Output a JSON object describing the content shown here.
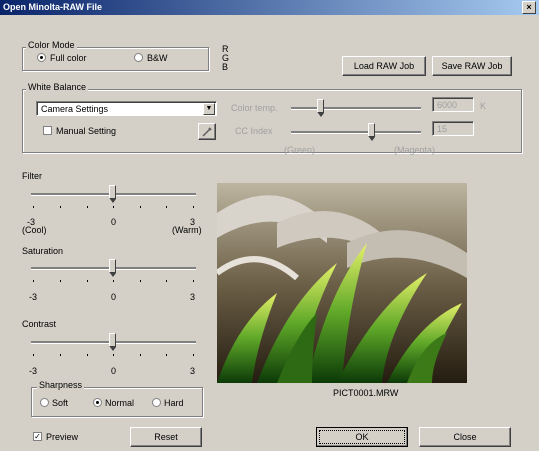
{
  "window": {
    "title": "Open Minolta-RAW File",
    "close_glyph": "×"
  },
  "color_mode": {
    "label": "Color Mode",
    "options": [
      {
        "label": "Full color",
        "selected": true
      },
      {
        "label": "B&W",
        "selected": false
      }
    ]
  },
  "rgb_labels": [
    "R",
    "G",
    "B"
  ],
  "raw_job": {
    "load_label": "Load RAW Job",
    "save_label": "Save RAW Job"
  },
  "white_balance": {
    "label": "White Balance",
    "preset": "Camera Settings",
    "manual_label": "Manual Setting",
    "color_temp_label": "Color temp.",
    "color_temp_value": "6000",
    "color_temp_unit": "K",
    "cc_index_label": "CC Index",
    "cc_index_value": "15",
    "green_label": "(Green)",
    "magenta_label": "(Magenta)"
  },
  "filter": {
    "label": "Filter",
    "min_label": "-3",
    "min_sub": "(Cool)",
    "mid_label": "0",
    "max_label": "3",
    "max_sub": "(Warm)",
    "value": 0
  },
  "saturation": {
    "label": "Saturation",
    "min_label": "-3",
    "mid_label": "0",
    "max_label": "3",
    "value": 0
  },
  "contrast": {
    "label": "Contrast",
    "min_label": "-3",
    "mid_label": "0",
    "max_label": "3",
    "value": 0
  },
  "sharpness": {
    "label": "Sharpness",
    "options": [
      {
        "label": "Soft",
        "selected": false
      },
      {
        "label": "Normal",
        "selected": true
      },
      {
        "label": "Hard",
        "selected": false
      }
    ]
  },
  "preview": {
    "label": "Preview",
    "checked": true,
    "filename": "PICT0001.MRW"
  },
  "buttons": {
    "reset": "Reset",
    "ok": "OK",
    "close": "Close"
  }
}
